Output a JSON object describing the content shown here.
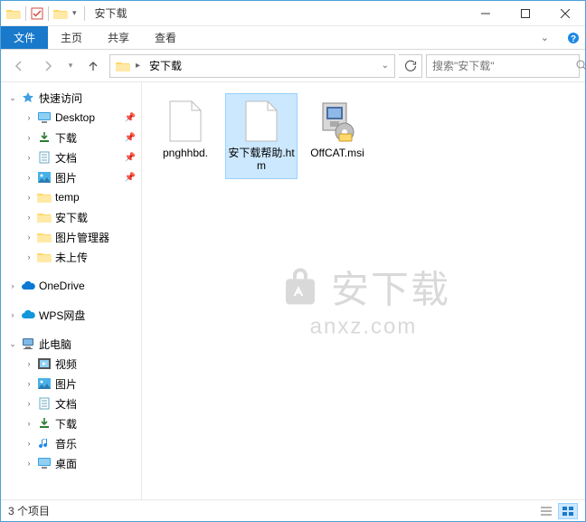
{
  "title": "安下载",
  "ribbon": {
    "file": "文件",
    "home": "主页",
    "share": "共享",
    "view": "查看"
  },
  "breadcrumb": {
    "seg1": "安下载",
    "dd_hint": "v"
  },
  "search": {
    "placeholder": "搜索\"安下载\""
  },
  "sidebar": {
    "quick_access": "快速访问",
    "items": [
      {
        "label": "Desktop",
        "pinned": true,
        "icon": "desktop"
      },
      {
        "label": "下载",
        "pinned": true,
        "icon": "downloads"
      },
      {
        "label": "文档",
        "pinned": true,
        "icon": "documents"
      },
      {
        "label": "图片",
        "pinned": true,
        "icon": "pictures"
      },
      {
        "label": "temp",
        "pinned": false,
        "icon": "folder"
      },
      {
        "label": "安下载",
        "pinned": false,
        "icon": "folder"
      },
      {
        "label": "图片管理器",
        "pinned": false,
        "icon": "folder"
      },
      {
        "label": "未上传",
        "pinned": false,
        "icon": "folder"
      }
    ],
    "onedrive": "OneDrive",
    "wps": "WPS网盘",
    "this_pc": "此电脑",
    "pc_items": [
      {
        "label": "视频",
        "icon": "videos"
      },
      {
        "label": "图片",
        "icon": "pictures"
      },
      {
        "label": "文档",
        "icon": "documents"
      },
      {
        "label": "下载",
        "icon": "downloads"
      },
      {
        "label": "音乐",
        "icon": "music"
      },
      {
        "label": "桌面",
        "icon": "desktop"
      }
    ]
  },
  "files": [
    {
      "name": "pnghhbd.",
      "type": "blank",
      "selected": false
    },
    {
      "name": "安下载帮助.htm",
      "type": "blank",
      "selected": true
    },
    {
      "name": "OffCAT.msi",
      "type": "msi",
      "selected": false
    }
  ],
  "statusbar": {
    "count_label": "3 个项目"
  },
  "watermark": {
    "cn": "安下载",
    "en": "anxz.com"
  }
}
